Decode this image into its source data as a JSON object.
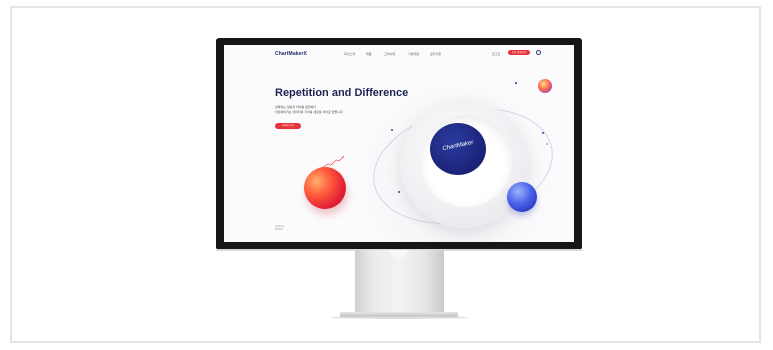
{
  "site": {
    "logo": "ChartMakerX",
    "nav_items": [
      "회사소개",
      "제품",
      "고객사례",
      "기술지원",
      "공지사항"
    ],
    "util_items": [
      "로그인"
    ],
    "nav_cta": "무료 체험하기"
  },
  "hero": {
    "title": "Repetition and Difference",
    "subtitle_line1": "반복되는 일상과 차이를 표현하다",
    "subtitle_line2": "차트메이커는 데이터의 가치를 새로운 차이로 만듭니다.",
    "button": "자세히 보기"
  },
  "graphic": {
    "core_label": "ChartMaker"
  },
  "footer_note": {
    "line1": "SCROLL",
    "line2": "DOWN"
  },
  "colors": {
    "brand_navy": "#1c2551",
    "accent_red": "#e8323a",
    "core_blue": "#1b2378"
  }
}
